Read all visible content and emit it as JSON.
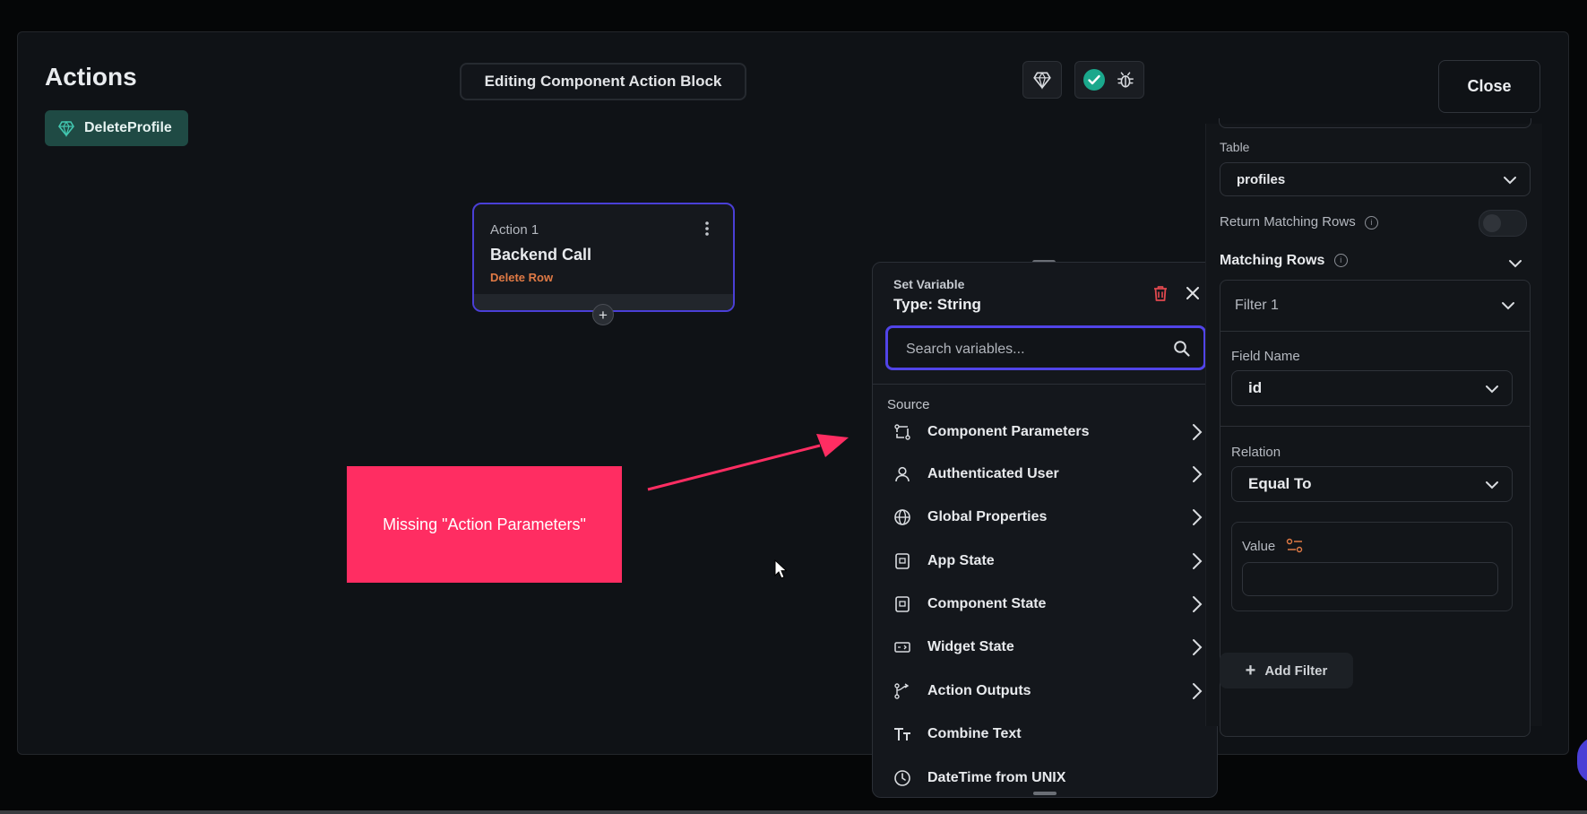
{
  "modal": {
    "title": "Actions",
    "action_chip": "DeleteProfile",
    "editing_label": "Editing Component Action Block",
    "close_label": "Close"
  },
  "action_card": {
    "label": "Action 1",
    "name": "Backend Call",
    "subtitle": "Delete Row"
  },
  "annotation": {
    "text": "Missing \"Action Parameters\""
  },
  "set_variable": {
    "header": "Set Variable",
    "type_label": "Type: String",
    "search_placeholder": "Search variables...",
    "source_label": "Source",
    "items": [
      {
        "label": "Component Parameters",
        "icon": "component-parameters-icon"
      },
      {
        "label": "Authenticated User",
        "icon": "user-icon"
      },
      {
        "label": "Global Properties",
        "icon": "globe-icon"
      },
      {
        "label": "App State",
        "icon": "app-state-icon"
      },
      {
        "label": "Component State",
        "icon": "component-state-icon"
      },
      {
        "label": "Widget State",
        "icon": "widget-state-icon"
      },
      {
        "label": "Action Outputs",
        "icon": "action-outputs-icon"
      },
      {
        "label": "Combine Text",
        "icon": "text-icon"
      },
      {
        "label": "DateTime from UNIX",
        "icon": "clock-icon"
      }
    ]
  },
  "right_panel": {
    "table_label": "Table",
    "table_value": "profiles",
    "return_matching_rows": "Return Matching Rows",
    "matching_rows": "Matching Rows",
    "filter_title": "Filter 1",
    "field_name_label": "Field Name",
    "field_name_value": "id",
    "relation_label": "Relation",
    "relation_value": "Equal To",
    "value_label": "Value",
    "add_filter": "Add Filter"
  },
  "colors": {
    "accent": "#5144e8",
    "callout": "#ff2d62",
    "chip": "#1f4a44",
    "warning": "#e07a45",
    "success": "#1aa88c"
  }
}
